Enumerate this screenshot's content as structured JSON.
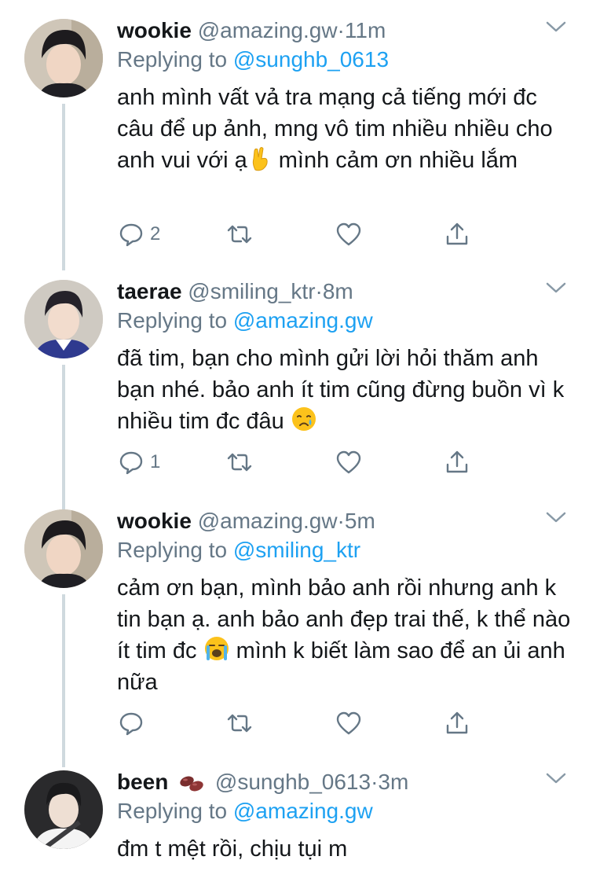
{
  "tweets": [
    {
      "name": "wookie",
      "handle": "@amazing.gw",
      "dot": "·",
      "time": "11m",
      "replying_prefix": "Replying to",
      "replying_to": "@sunghb_0613",
      "text_a": "anh mình vất vả tra mạng cả tiếng mới đc câu để up ảnh, mng vô tim nhiều nhiều cho anh vui với ạ",
      "text_b": " mình cảm ơn nhiều lắm",
      "emoji": "crossed-fingers",
      "reply_count": "2"
    },
    {
      "name": "taerae",
      "handle": "@smiling_ktr",
      "dot": "·",
      "time": "8m",
      "replying_prefix": "Replying to",
      "replying_to": "@amazing.gw",
      "text_a": "đã tim, bạn cho mình gửi lời hỏi thăm anh bạn nhé. bảo anh ít tim cũng đừng buồn vì k nhiều tim đc đâu",
      "text_b": "",
      "emoji": "crying-face",
      "reply_count": "1"
    },
    {
      "name": "wookie",
      "handle": "@amazing.gw",
      "dot": "·",
      "time": "5m",
      "replying_prefix": "Replying to",
      "replying_to": "@smiling_ktr",
      "text_a": "cảm ơn bạn, mình bảo anh rồi nhưng anh k tin bạn ạ. anh bảo anh đẹp trai thế, k thể nào ít tim đc",
      "text_b": " mình k biết làm sao để an ủi anh nữa",
      "emoji": "loudly-crying-face",
      "reply_count": ""
    },
    {
      "name": "been",
      "handle": "@sunghb_0613",
      "dot": "·",
      "time": "3m",
      "replying_prefix": "Replying to",
      "replying_to": "@amazing.gw",
      "text_a": "đm t mệt rồi, chịu tụi m",
      "text_b": "",
      "badge": "beans-emoji",
      "reply_count": ""
    }
  ],
  "colors": {
    "link": "#1da1f2",
    "secondary": "#657786",
    "thread_line": "#cfd9de"
  }
}
